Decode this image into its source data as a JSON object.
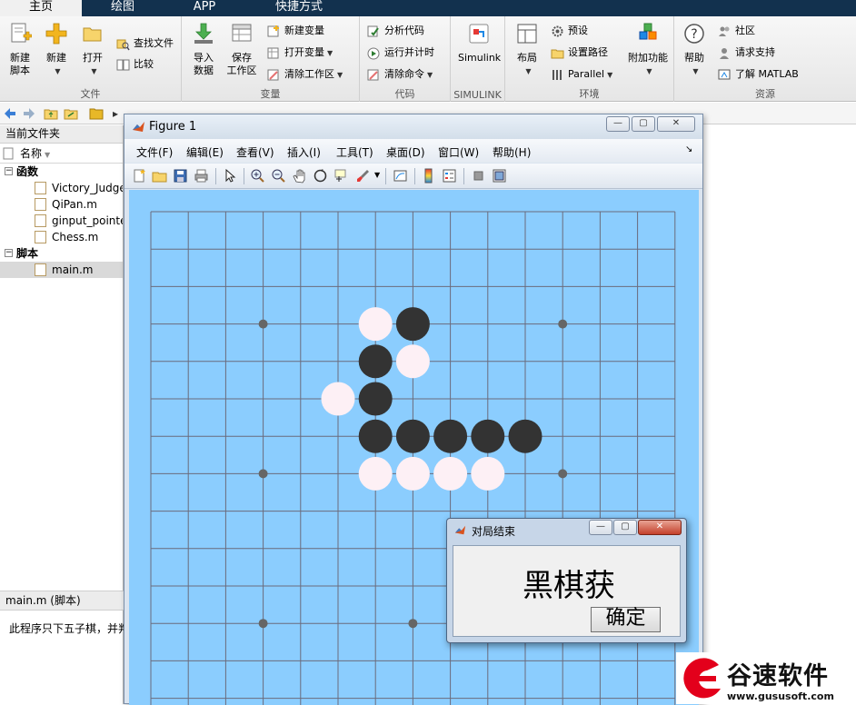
{
  "tabs": [
    {
      "label": "主页",
      "active": true
    },
    {
      "label": "绘图",
      "active": false
    },
    {
      "label": "APP",
      "active": false
    },
    {
      "label": "快捷方式",
      "active": false
    }
  ],
  "ribbon": {
    "file_group": {
      "label": "文件",
      "new_script": "新建\n脚本",
      "new": "新建",
      "open": "打开",
      "find_files": "查找文件",
      "compare": "比较"
    },
    "variable_group": {
      "label": "变量",
      "import_data": "导入\n数据",
      "save_workspace": "保存\n工作区",
      "new_variable": "新建变量",
      "open_variable": "打开变量",
      "clear_workspace": "清除工作区"
    },
    "code_group": {
      "label": "代码",
      "analyze_code": "分析代码",
      "run_and_time": "运行并计时",
      "clear_commands": "清除命令"
    },
    "simulink_group": {
      "label": "SIMULINK",
      "simulink": "Simulink"
    },
    "env_group": {
      "label": "环境",
      "layout": "布局",
      "preferences": "预设",
      "set_path": "设置路径",
      "parallel": "Parallel",
      "addons": "附加功能"
    },
    "resources_group": {
      "label": "资源",
      "help": "帮助",
      "community": "社区",
      "request_support": "请求支持",
      "learn_matlab": "了解 MATLAB"
    }
  },
  "current_folder": {
    "title": "当前文件夹",
    "column_name": "名称",
    "sections": [
      {
        "label": "函数",
        "files": [
          "Victory_Judge",
          "QiPan.m",
          "ginput_pointer",
          "Chess.m"
        ]
      },
      {
        "label": "脚本",
        "files": [
          "main.m"
        ]
      }
    ],
    "selected_file": "main.m",
    "detail_title": "main.m  (脚本)",
    "detail_text": "此程序只下五子棋，并判"
  },
  "figure": {
    "title": "Figure 1",
    "menu": [
      "文件(F)",
      "编辑(E)",
      "查看(V)",
      "插入(I)",
      "工具(T)",
      "桌面(D)",
      "窗口(W)",
      "帮助(H)"
    ],
    "board": {
      "lines": 15,
      "star_points": [
        [
          3,
          3
        ],
        [
          11,
          3
        ],
        [
          3,
          7
        ],
        [
          11,
          7
        ],
        [
          3,
          11
        ],
        [
          7,
          11
        ]
      ],
      "black_stones": [
        [
          7,
          3
        ],
        [
          6,
          4
        ],
        [
          6,
          5
        ],
        [
          6,
          6
        ],
        [
          7,
          6
        ],
        [
          8,
          6
        ],
        [
          9,
          6
        ],
        [
          10,
          6
        ]
      ],
      "white_stones": [
        [
          6,
          3
        ],
        [
          7,
          4
        ],
        [
          5,
          5
        ],
        [
          6,
          7
        ],
        [
          7,
          7
        ],
        [
          8,
          7
        ],
        [
          9,
          7
        ]
      ],
      "colors": {
        "background": "#8bcdfe",
        "line": "#6b6b7c",
        "black": "#333333",
        "white": "#fdf0f5",
        "star": "#666666"
      }
    }
  },
  "dialog": {
    "title": "对局结束",
    "message": "黑棋获",
    "ok_label": "确定"
  },
  "watermark": {
    "text": "谷速软件",
    "url": "www.gususoft.com",
    "color": "#e3001b"
  }
}
